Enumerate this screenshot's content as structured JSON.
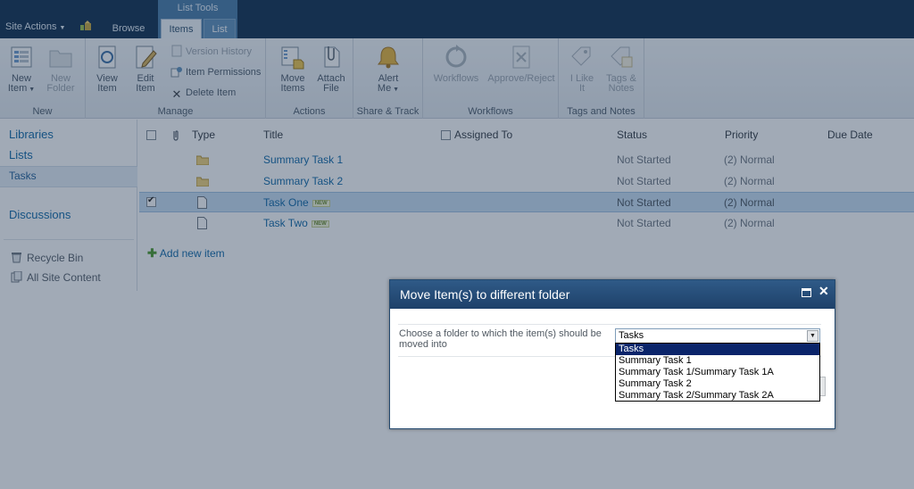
{
  "topbar": {
    "site_actions": "Site Actions",
    "tab_browse": "Browse",
    "context_group": "List Tools",
    "tab_items": "Items",
    "tab_list": "List"
  },
  "ribbon": {
    "groups": {
      "new": "New",
      "manage": "Manage",
      "actions": "Actions",
      "share_track": "Share & Track",
      "workflows": "Workflows",
      "tags_notes": "Tags and Notes"
    },
    "buttons": {
      "new_item_1": "New",
      "new_item_2": "Item",
      "new_folder_1": "New",
      "new_folder_2": "Folder",
      "view_item_1": "View",
      "view_item_2": "Item",
      "edit_item_1": "Edit",
      "edit_item_2": "Item",
      "version_history": "Version History",
      "item_permissions": "Item Permissions",
      "delete_item": "Delete Item",
      "move_items_1": "Move",
      "move_items_2": "Items",
      "attach_file_1": "Attach",
      "attach_file_2": "File",
      "alert_me_1": "Alert",
      "alert_me_2": "Me",
      "workflows": "Workflows",
      "approve_reject": "Approve/Reject",
      "i_like_it_1": "I Like",
      "i_like_it_2": "It",
      "tags_notes_1": "Tags &",
      "tags_notes_2": "Notes"
    }
  },
  "leftnav": {
    "libraries": "Libraries",
    "lists": "Lists",
    "tasks": "Tasks",
    "discussions": "Discussions",
    "recycle_bin": "Recycle Bin",
    "all_site_content": "All Site Content"
  },
  "list": {
    "headers": {
      "type": "Type",
      "title": "Title",
      "assigned_to": "Assigned To",
      "status": "Status",
      "priority": "Priority",
      "due_date": "Due Date"
    },
    "rows": [
      {
        "title": "Summary Task 1",
        "status": "Not Started",
        "priority": "(2) Normal"
      },
      {
        "title": "Summary Task 2",
        "status": "Not Started",
        "priority": "(2) Normal"
      },
      {
        "title": "Task One",
        "badge": "NEW",
        "status": "Not Started",
        "priority": "(2) Normal"
      },
      {
        "title": "Task Two",
        "badge": "NEW",
        "status": "Not Started",
        "priority": "(2) Normal"
      }
    ],
    "add_new_item": "Add new item"
  },
  "dialog": {
    "title": "Move Item(s) to different folder",
    "prompt": "Choose a folder to which the item(s) should be moved into",
    "selected_value": "Tasks",
    "options": [
      "Tasks",
      "Summary Task 1",
      "Summary Task 1/Summary Task 1A",
      "Summary Task 2",
      "Summary Task 2/Summary Task 2A"
    ]
  }
}
